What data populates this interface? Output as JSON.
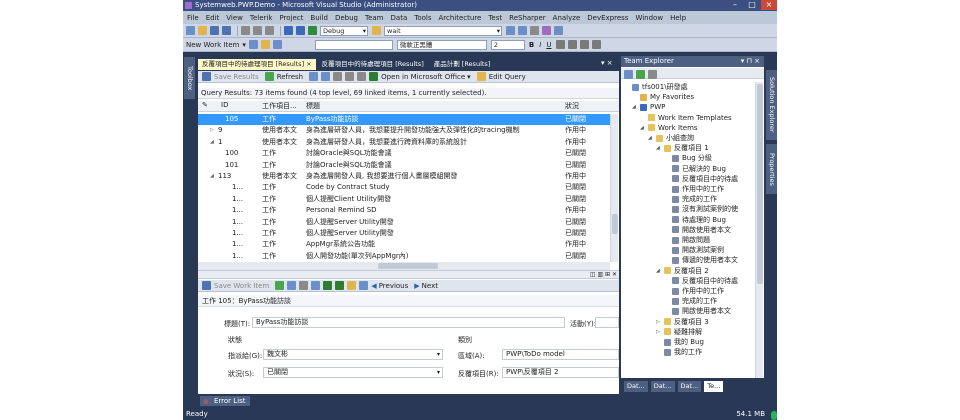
{
  "window": {
    "title": "Systemweb.PWP.Demo - Microsoft Visual Studio (Administrator)"
  },
  "menu": [
    "File",
    "Edit",
    "View",
    "Telerik",
    "Project",
    "Build",
    "Debug",
    "Team",
    "Data",
    "Tools",
    "Architecture",
    "Test",
    "ReSharper",
    "Analyze",
    "DevExpress",
    "Window",
    "Help"
  ],
  "toolbar1": {
    "config": "Debug",
    "target": "wait"
  },
  "toolbar2": {
    "new_work_item": "New Work Item",
    "font": "微軟正黑體",
    "size": "2"
  },
  "toolbox_label": "Toolbox",
  "doc_tabs": [
    {
      "label": "反覆項目中的待處理項目 [Results]",
      "active": true
    },
    {
      "label": "反覆項目中的待處理項目 [Results]",
      "active": false
    },
    {
      "label": "產品計劃 [Results]",
      "active": false
    }
  ],
  "results_toolbar": {
    "save": "Save Results",
    "refresh": "Refresh",
    "open_office": "Open in Microsoft Office",
    "edit_query": "Edit Query"
  },
  "query_summary": "Query Results: 73 items found (4 top level, 69 linked items, 1 currently selected).",
  "columns": {
    "id": "ID",
    "type": "工作項目...",
    "title": "標題",
    "state": "狀況"
  },
  "rows": [
    {
      "expander": "",
      "id": "105",
      "type": "工作",
      "title": "ByPass功能訪談",
      "state": "已關閉",
      "selected": true,
      "indent": 1
    },
    {
      "expander": "▷",
      "id": "9",
      "type": "使用者本文",
      "title": "身為進層研發人員，我想要提升開發功能強大及彈性化的tracing機制",
      "state": "作用中",
      "selected": false,
      "indent": 0
    },
    {
      "expander": "◢",
      "id": "1",
      "type": "使用者本文",
      "title": "身為進層研發人員，我想要進行跨資料庫的系統設計",
      "state": "作用中",
      "selected": false,
      "indent": 0
    },
    {
      "expander": "",
      "id": "100",
      "type": "工作",
      "title": "討論Oracle與SQL功能會議",
      "state": "已關閉",
      "selected": false,
      "indent": 1
    },
    {
      "expander": "",
      "id": "101",
      "type": "工作",
      "title": "討論Oracle與SQL功能會議",
      "state": "已關閉",
      "selected": false,
      "indent": 1
    },
    {
      "expander": "◢",
      "id": "113",
      "type": "使用者本文",
      "title": "身為進層開發人員, 我想要進行個人畫層模組開發",
      "state": "作用中",
      "selected": false,
      "indent": 0
    },
    {
      "expander": "",
      "id": "1...",
      "type": "工作",
      "title": "Code by Contract Study",
      "state": "已關閉",
      "selected": false,
      "indent": 2
    },
    {
      "expander": "",
      "id": "1...",
      "type": "工作",
      "title": "個人提醒Client Utility開發",
      "state": "已關閉",
      "selected": false,
      "indent": 2
    },
    {
      "expander": "",
      "id": "1...",
      "type": "工作",
      "title": "Personal Remind SD",
      "state": "作用中",
      "selected": false,
      "indent": 2
    },
    {
      "expander": "",
      "id": "1...",
      "type": "工作",
      "title": "個人提醒Server Utility開發",
      "state": "已關閉",
      "selected": false,
      "indent": 2
    },
    {
      "expander": "",
      "id": "1...",
      "type": "工作",
      "title": "個人提醒Server Utility開發",
      "state": "已關閉",
      "selected": false,
      "indent": 2
    },
    {
      "expander": "",
      "id": "1...",
      "type": "工作",
      "title": "AppMgr系統公告功能",
      "state": "作用中",
      "selected": false,
      "indent": 2
    },
    {
      "expander": "",
      "id": "1...",
      "type": "工作",
      "title": "個人開發功能(單次列AppMgr內)",
      "state": "已關閉",
      "selected": false,
      "indent": 2
    }
  ],
  "workitem_toolbar": {
    "save": "Save Work Item",
    "previous": "Previous",
    "next": "Next"
  },
  "form": {
    "header": "工作 105：ByPass功能訪談",
    "title_label": "標題(T):",
    "title_value": "ByPass功能訪談",
    "activity_label": "活動(Y):",
    "status_section": "狀態",
    "assign_label": "指派給(G):",
    "assign_value": "魏文彬",
    "state_label": "狀況(S):",
    "state_value": "已關閉",
    "class_section": "類別",
    "area_label": "區域(A):",
    "area_value": "PWP\\ToDo model",
    "iter_label": "反覆項目(R):",
    "iter_value": "PWP\\反覆項目 2"
  },
  "error_list": "Error List",
  "status": {
    "ready": "Ready",
    "memory": "54.1 MB"
  },
  "team_explorer": {
    "title": "Team Explorer",
    "pin": "▾ ⊓ ×",
    "tree": [
      {
        "label": "tfs001\\研發處",
        "level": 0,
        "icon": "server",
        "exp": ""
      },
      {
        "label": "My Favorites",
        "level": 1,
        "icon": "star",
        "exp": ""
      },
      {
        "label": "PWP",
        "level": 1,
        "icon": "project",
        "exp": "◢"
      },
      {
        "label": "Work Item Templates",
        "level": 2,
        "icon": "folder",
        "exp": ""
      },
      {
        "label": "Work Items",
        "level": 2,
        "icon": "folder",
        "exp": "◢"
      },
      {
        "label": "小組查詢",
        "level": 3,
        "icon": "folder",
        "exp": "◢"
      },
      {
        "label": "反覆項目 1",
        "level": 4,
        "icon": "folder",
        "exp": "◢"
      },
      {
        "label": "Bug 分級",
        "level": 5,
        "icon": "query",
        "exp": ""
      },
      {
        "label": "已解決的 Bug",
        "level": 5,
        "icon": "query",
        "exp": ""
      },
      {
        "label": "反覆項目中的待處",
        "level": 5,
        "icon": "query",
        "exp": ""
      },
      {
        "label": "作用中的工作",
        "level": 5,
        "icon": "query",
        "exp": ""
      },
      {
        "label": "完成的工作",
        "level": 5,
        "icon": "query",
        "exp": ""
      },
      {
        "label": "沒有測試案例的使",
        "level": 5,
        "icon": "query",
        "exp": ""
      },
      {
        "label": "待處理的 Bug",
        "level": 5,
        "icon": "query",
        "exp": ""
      },
      {
        "label": "開啟使用者本文",
        "level": 5,
        "icon": "query",
        "exp": ""
      },
      {
        "label": "開啟問題",
        "level": 5,
        "icon": "query",
        "exp": ""
      },
      {
        "label": "開啟測試案例",
        "level": 5,
        "icon": "query",
        "exp": ""
      },
      {
        "label": "傳遞的使用者本文",
        "level": 5,
        "icon": "query",
        "exp": ""
      },
      {
        "label": "反覆項目 2",
        "level": 4,
        "icon": "folder",
        "exp": "◢"
      },
      {
        "label": "反覆項目中的待處",
        "level": 5,
        "icon": "query",
        "exp": ""
      },
      {
        "label": "作用中的工作",
        "level": 5,
        "icon": "query",
        "exp": ""
      },
      {
        "label": "完成的工作",
        "level": 5,
        "icon": "query",
        "exp": ""
      },
      {
        "label": "開啟使用者本文",
        "level": 5,
        "icon": "query",
        "exp": ""
      },
      {
        "label": "反覆項目 3",
        "level": 4,
        "icon": "folder",
        "exp": "▷"
      },
      {
        "label": "疑難排解",
        "level": 4,
        "icon": "folder",
        "exp": "▷"
      },
      {
        "label": "我的 Bug",
        "level": 4,
        "icon": "query",
        "exp": ""
      },
      {
        "label": "我的工作",
        "level": 4,
        "icon": "query",
        "exp": ""
      }
    ],
    "bottom_tabs": [
      {
        "label": "Dat...",
        "active": false
      },
      {
        "label": "Dat...",
        "active": false
      },
      {
        "label": "Dat...",
        "active": false
      },
      {
        "label": "Te...",
        "active": true
      }
    ]
  },
  "right_tabs": [
    "Solution Explorer",
    "Properties"
  ],
  "colors": {
    "chrome": "#293955",
    "accent": "#3399ff",
    "active_tab": "#fff8c8"
  }
}
